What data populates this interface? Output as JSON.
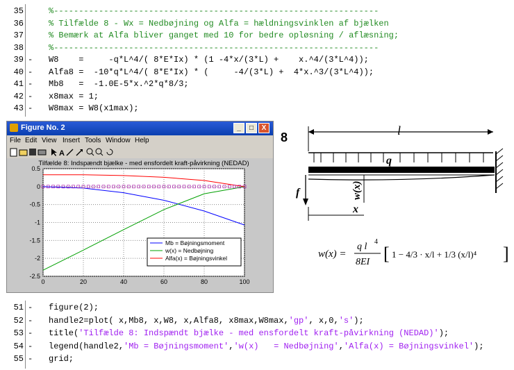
{
  "editor_top": {
    "lines": [
      {
        "num": "35",
        "dash": "",
        "code": "%-----------------------------------------------------------------",
        "type": "comment"
      },
      {
        "num": "36",
        "dash": "",
        "code": "% Tilfælde 8 - Wx = Nedbøjning og Alfa = hældningsvinklen af bjælken",
        "type": "comment"
      },
      {
        "num": "37",
        "dash": "",
        "code": "% Bemærk at Alfa bliver ganget med 10 for bedre opløsning / aflæsning;",
        "type": "comment"
      },
      {
        "num": "38",
        "dash": "",
        "code": "%-----------------------------------------------------------------",
        "type": "comment"
      },
      {
        "num": "39",
        "dash": "-",
        "code": "W8    =     -q*L^4/( 8*E*Ix) * (1 -4*x/(3*L) +    x.^4/(3*L^4));",
        "type": "code"
      },
      {
        "num": "40",
        "dash": "-",
        "code": "Alfa8 =  -10*q*L^4/( 8*E*Ix) * (     -4/(3*L) +  4*x.^3/(3*L^4));",
        "type": "code"
      },
      {
        "num": "41",
        "dash": "-",
        "code": "Mb8   =  -1.0E-5*x.^2*q*8/3;",
        "type": "code"
      },
      {
        "num": "42",
        "dash": "-",
        "code": "x8max = 1;",
        "type": "code"
      },
      {
        "num": "43",
        "dash": "-",
        "code": "W8max = W8(x1max);",
        "type": "code"
      }
    ]
  },
  "figure": {
    "title": "Figure No. 2",
    "menus": [
      "File",
      "Edit",
      "View",
      "Insert",
      "Tools",
      "Window",
      "Help"
    ],
    "toolbar_icons": [
      "new-icon",
      "open-icon",
      "save-icon",
      "print-icon",
      "arrow-icon",
      "text-A-icon",
      "line-icon",
      "arrow-line-icon",
      "zoom-in-icon",
      "zoom-out-icon",
      "rotate-icon"
    ],
    "toolbar_A": "A",
    "minimize": "_",
    "maximize": "□",
    "close": "X"
  },
  "chart_data": {
    "type": "line",
    "title": "Tilfælde 8: Indspændt bjælke - med ensfordelt kraft-påvirkning (NEDAD)",
    "xlim": [
      0,
      100
    ],
    "ylim": [
      -2.5,
      0.5
    ],
    "xticks": [
      "0",
      "20",
      "40",
      "60",
      "80",
      "100"
    ],
    "yticks": [
      "0.5",
      "0",
      "-0.5",
      "-1",
      "-1.5",
      "-2",
      "-2.5"
    ],
    "grid": true,
    "legend_position": "lower-right-inside",
    "series": [
      {
        "name": "Mb = Bøjningsmoment",
        "color": "#0000ff",
        "x": [
          0,
          20,
          40,
          60,
          80,
          100
        ],
        "values": [
          0,
          -0.04,
          -0.17,
          -0.38,
          -0.68,
          -1.07
        ]
      },
      {
        "name": "w(x)   = Nedbøjning",
        "color": "#00a000",
        "x": [
          0,
          20,
          40,
          60,
          80,
          100
        ],
        "values": [
          -2.33,
          -1.77,
          -1.2,
          -0.64,
          -0.2,
          0
        ]
      },
      {
        "name": "Alfa(x) = Bøjningsvinkel",
        "color": "#ff0000",
        "x": [
          0,
          20,
          40,
          60,
          80,
          100
        ],
        "values": [
          0.33,
          0.33,
          0.31,
          0.26,
          0.17,
          0
        ]
      }
    ]
  },
  "diagram": {
    "case_number": "8",
    "length_label": "l",
    "load_label": "q",
    "deflection_label": "w(x)",
    "x_label": "x",
    "f_label": "f",
    "formula_lhs": "w(x) =",
    "formula_coef_num": "q l",
    "formula_coef_exp": "4",
    "formula_coef_den": "8EI",
    "formula_bracket": "1 − 4/3 · x/l + 1/3 (x/l)⁴"
  },
  "editor_bottom": {
    "lines": [
      {
        "num": "51",
        "dash": "-",
        "parts": [
          {
            "t": "figure(2);",
            "c": "code"
          }
        ]
      },
      {
        "num": "52",
        "dash": "-",
        "parts": [
          {
            "t": "handle2=plot( x,Mb8, x,W8, x,Alfa8, x8max,W8max,",
            "c": "code"
          },
          {
            "t": "'gp'",
            "c": "str"
          },
          {
            "t": ", x,0,",
            "c": "code"
          },
          {
            "t": "'s'",
            "c": "str"
          },
          {
            "t": ");",
            "c": "code"
          }
        ]
      },
      {
        "num": "53",
        "dash": "-",
        "parts": [
          {
            "t": "title(",
            "c": "code"
          },
          {
            "t": "'Tilfælde 8: Indspændt bjælke - med ensfordelt kraft-påvirkning (NEDAD)'",
            "c": "str"
          },
          {
            "t": ");",
            "c": "code"
          }
        ]
      },
      {
        "num": "54",
        "dash": "-",
        "parts": [
          {
            "t": "legend(handle2,",
            "c": "code"
          },
          {
            "t": "'Mb = Bøjningsmoment'",
            "c": "str"
          },
          {
            "t": ",",
            "c": "code"
          },
          {
            "t": "'w(x)   = Nedbøjning'",
            "c": "str"
          },
          {
            "t": ",",
            "c": "code"
          },
          {
            "t": "'Alfa(x) = Bøjningsvinkel'",
            "c": "str"
          },
          {
            "t": ");",
            "c": "code"
          }
        ]
      },
      {
        "num": "55",
        "dash": "-",
        "parts": [
          {
            "t": "grid;",
            "c": "code"
          }
        ]
      }
    ]
  }
}
